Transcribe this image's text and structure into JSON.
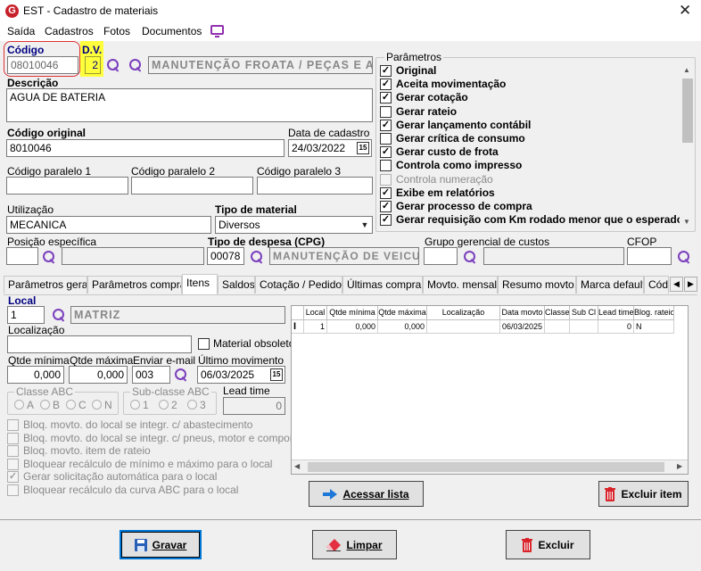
{
  "window": {
    "title": "EST - Cadastro de materiais"
  },
  "menu": [
    "Saída",
    "Cadastros",
    "Fotos",
    "Documentos"
  ],
  "codigo": {
    "label": "Código",
    "value": "08010046"
  },
  "dv": {
    "label": "D.V.",
    "value": "2"
  },
  "grupo": {
    "value": "MANUTENÇÃO FROATA / PEÇAS E ACESS"
  },
  "descricao": {
    "label": "Descrição",
    "value": "AGUA DE BATERIA"
  },
  "codigo_original": {
    "label": "Código original",
    "value": "8010046"
  },
  "data_cadastro": {
    "label": "Data de cadastro",
    "value": "24/03/2022"
  },
  "paralelos": [
    {
      "label": "Código paralelo 1",
      "value": ""
    },
    {
      "label": "Código paralelo 2",
      "value": ""
    },
    {
      "label": "Código paralelo 3",
      "value": ""
    }
  ],
  "utilizacao": {
    "label": "Utilização",
    "value": "MECANICA"
  },
  "tipo_material": {
    "label": "Tipo de material",
    "value": "Diversos"
  },
  "posicao": {
    "label": "Posição específica",
    "value": ""
  },
  "tipo_despesa": {
    "label": "Tipo de despesa (CPG)",
    "code": "00078",
    "value": "MANUTENÇÃO DE VEICULO"
  },
  "grupo_gerencial": {
    "label": "Grupo gerencial de custos",
    "value": ""
  },
  "cfop": {
    "label": "CFOP",
    "value": ""
  },
  "parametros": {
    "title": "Parâmetros",
    "items": [
      {
        "label": "Original",
        "checked": true,
        "enabled": true
      },
      {
        "label": "Aceita movimentação",
        "checked": true,
        "enabled": true
      },
      {
        "label": "Gerar cotação",
        "checked": true,
        "enabled": true
      },
      {
        "label": "Gerar rateio",
        "checked": false,
        "enabled": true
      },
      {
        "label": "Gerar lançamento contábil",
        "checked": true,
        "enabled": true
      },
      {
        "label": "Gerar crítica de consumo",
        "checked": false,
        "enabled": true
      },
      {
        "label": "Gerar custo de frota",
        "checked": true,
        "enabled": true
      },
      {
        "label": "Controla como impresso",
        "checked": false,
        "enabled": true
      },
      {
        "label": "Controla numeração",
        "checked": false,
        "enabled": false
      },
      {
        "label": "Exibe em relatórios",
        "checked": true,
        "enabled": true
      },
      {
        "label": "Gerar processo de compra",
        "checked": true,
        "enabled": true
      },
      {
        "label": "Gerar requisição com Km rodado menor que o esperado",
        "checked": true,
        "enabled": true
      }
    ]
  },
  "tabs": [
    "Parâmetros gerais",
    "Parâmetros compras",
    "Itens",
    "Saldos",
    "Cotação / Pedido",
    "Últimas compras",
    "Movto. mensal",
    "Resumo movto.",
    "Marca default",
    "Códi"
  ],
  "active_tab": "Itens",
  "itens": {
    "local_label": "Local",
    "local_code": "1",
    "local_name": "MATRIZ",
    "localizacao_label": "Localização",
    "localizacao_value": "",
    "material_obsoleto": "Material obsoleto",
    "qtde_minima_label": "Qtde mínima",
    "qtde_minima": "0,000",
    "qtde_maxima_label": "Qtde máxima",
    "qtde_maxima": "0,000",
    "enviar_email_label": "Enviar e-mail",
    "enviar_email": "003",
    "ultimo_movimento_label": "Último movimento",
    "ultimo_movimento": "06/03/2025",
    "classe_abc_label": "Classe ABC",
    "classe_abc_opts": [
      "A",
      "B",
      "C",
      "N"
    ],
    "subclasse_abc_label": "Sub-classe ABC",
    "subclasse_abc_opts": [
      "1",
      "2",
      "3"
    ],
    "lead_time_label": "Lead time",
    "lead_time": "0",
    "options": [
      {
        "label": "Bloq. movto. do local se integr. c/ abastecimento",
        "checked": false
      },
      {
        "label": "Bloq. movto. do local se integr. c/ pneus, motor e componente",
        "checked": false
      },
      {
        "label": "Bloq. movto. item de rateio",
        "checked": false
      },
      {
        "label": "Bloquear recálculo de mínimo e máximo para o local",
        "checked": false
      },
      {
        "label": "Gerar solicitação automática para o local",
        "checked": true
      },
      {
        "label": "Bloquear recálculo da curva ABC para o local",
        "checked": false
      }
    ]
  },
  "grid": {
    "columns": [
      "Local",
      "Qtde mínima",
      "Qtde máxima",
      "Localização",
      "Data movto",
      "Classe",
      "Sub Cl",
      "Lead time",
      "Blog. rateio"
    ],
    "rows": [
      [
        "1",
        "0,000",
        "0,000",
        "",
        "06/03/2025",
        "",
        "",
        "0",
        "N"
      ]
    ]
  },
  "buttons": {
    "acessar_lista": "Acessar lista",
    "excluir_item": "Excluir item",
    "gravar": "Gravar",
    "limpar": "Limpar",
    "excluir": "Excluir"
  },
  "colors": {
    "accent": "#7b3fbd",
    "highlight": "#ffff3c",
    "brand": "#c8202a"
  }
}
